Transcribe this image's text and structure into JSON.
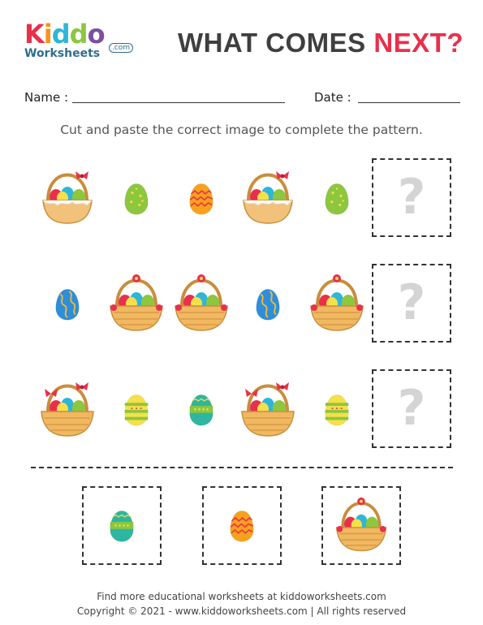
{
  "logo": {
    "letters": [
      "K",
      "i",
      "d",
      "d",
      "o"
    ],
    "letter_colors": [
      "#e8304b",
      "#f7941d",
      "#2eb6d8",
      "#8dc63f",
      "#7b4fa0"
    ],
    "sub": "Worksheets",
    "com": ".com"
  },
  "title": {
    "part1": "WHAT COMES ",
    "part2": "NEXT?"
  },
  "fields": {
    "name_label": "Name :",
    "date_label": "Date :"
  },
  "instruction": "Cut and paste the correct image to complete the pattern.",
  "rows": [
    {
      "items": [
        "basket-a-icon",
        "green-egg-icon",
        "orange-egg-icon",
        "basket-a-icon",
        "green-egg-icon"
      ],
      "question": "?"
    },
    {
      "items": [
        "blue-egg-icon",
        "basket-b-icon",
        "basket-c-icon",
        "blue-egg-icon",
        "basket-b-icon"
      ],
      "question": "?"
    },
    {
      "items": [
        "basket-d-icon",
        "striped-egg-icon",
        "dotted-egg-icon",
        "basket-d-icon",
        "striped-egg-icon"
      ],
      "question": "?"
    }
  ],
  "options": [
    "dotted-egg-icon",
    "orange-egg-icon",
    "basket-b-icon"
  ],
  "footer": {
    "line1": "Find more educational worksheets at kiddoworksheets.com",
    "line2": "Copyright © 2021 - www.kiddoworksheets.com  |  All rights reserved"
  }
}
